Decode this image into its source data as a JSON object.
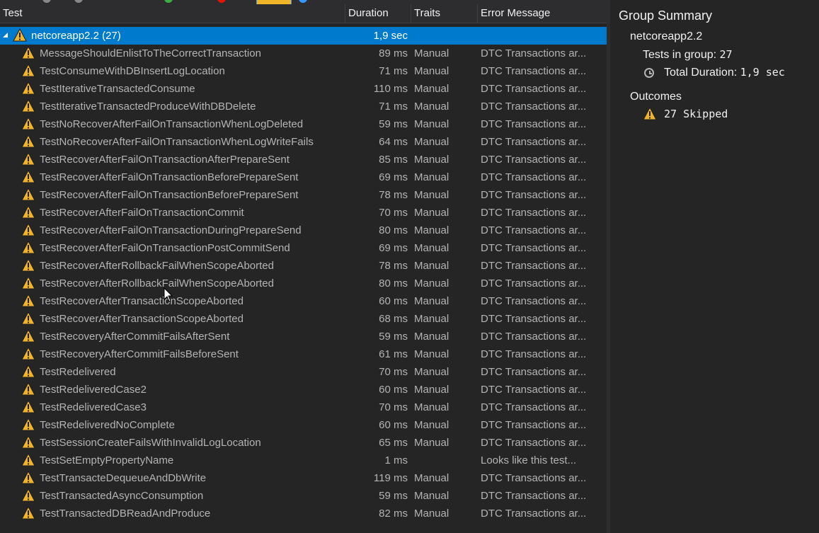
{
  "columns": {
    "test": "Test",
    "duration": "Duration",
    "traits": "Traits",
    "error": "Error Message"
  },
  "group": {
    "name": "netcoreapp2.2  (27)",
    "duration": "1,9 sec"
  },
  "rows": [
    {
      "name": "MessageShouldEnlistToTheCorrectTransaction",
      "duration": "89 ms",
      "traits": "Manual",
      "error": "DTC Transactions ar..."
    },
    {
      "name": "TestConsumeWithDBInsertLogLocation",
      "duration": "71 ms",
      "traits": "Manual",
      "error": "DTC Transactions ar..."
    },
    {
      "name": "TestIterativeTransactedConsume",
      "duration": "110 ms",
      "traits": "Manual",
      "error": "DTC Transactions ar..."
    },
    {
      "name": "TestIterativeTransactedProduceWithDBDelete",
      "duration": "71 ms",
      "traits": "Manual",
      "error": "DTC Transactions ar..."
    },
    {
      "name": "TestNoRecoverAfterFailOnTransactionWhenLogDeleted",
      "duration": "59 ms",
      "traits": "Manual",
      "error": "DTC Transactions ar..."
    },
    {
      "name": "TestNoRecoverAfterFailOnTransactionWhenLogWriteFails",
      "duration": "64 ms",
      "traits": "Manual",
      "error": "DTC Transactions ar..."
    },
    {
      "name": "TestRecoverAfterFailOnTransactionAfterPrepareSent",
      "duration": "85 ms",
      "traits": "Manual",
      "error": "DTC Transactions ar..."
    },
    {
      "name": "TestRecoverAfterFailOnTransactionBeforePrepareSent",
      "duration": "69 ms",
      "traits": "Manual",
      "error": "DTC Transactions ar..."
    },
    {
      "name": "TestRecoverAfterFailOnTransactionBeforePrepareSent",
      "duration": "78 ms",
      "traits": "Manual",
      "error": "DTC Transactions ar..."
    },
    {
      "name": "TestRecoverAfterFailOnTransactionCommit",
      "duration": "70 ms",
      "traits": "Manual",
      "error": "DTC Transactions ar..."
    },
    {
      "name": "TestRecoverAfterFailOnTransactionDuringPrepareSend",
      "duration": "80 ms",
      "traits": "Manual",
      "error": "DTC Transactions ar..."
    },
    {
      "name": "TestRecoverAfterFailOnTransactionPostCommitSend",
      "duration": "69 ms",
      "traits": "Manual",
      "error": "DTC Transactions ar..."
    },
    {
      "name": "TestRecoverAfterRollbackFailWhenScopeAborted",
      "duration": "78 ms",
      "traits": "Manual",
      "error": "DTC Transactions ar..."
    },
    {
      "name": "TestRecoverAfterRollbackFailWhenScopeAborted",
      "duration": "80 ms",
      "traits": "Manual",
      "error": "DTC Transactions ar..."
    },
    {
      "name": "TestRecoverAfterTransactionScopeAborted",
      "duration": "60 ms",
      "traits": "Manual",
      "error": "DTC Transactions ar..."
    },
    {
      "name": "TestRecoverAfterTransactionScopeAborted",
      "duration": "68 ms",
      "traits": "Manual",
      "error": "DTC Transactions ar..."
    },
    {
      "name": "TestRecoveryAfterCommitFailsAfterSent",
      "duration": "59 ms",
      "traits": "Manual",
      "error": "DTC Transactions ar..."
    },
    {
      "name": "TestRecoveryAfterCommitFailsBeforeSent",
      "duration": "61 ms",
      "traits": "Manual",
      "error": "DTC Transactions ar..."
    },
    {
      "name": "TestRedelivered",
      "duration": "70 ms",
      "traits": "Manual",
      "error": "DTC Transactions ar..."
    },
    {
      "name": "TestRedeliveredCase2",
      "duration": "60 ms",
      "traits": "Manual",
      "error": "DTC Transactions ar..."
    },
    {
      "name": "TestRedeliveredCase3",
      "duration": "70 ms",
      "traits": "Manual",
      "error": "DTC Transactions ar..."
    },
    {
      "name": "TestRedeliveredNoComplete",
      "duration": "60 ms",
      "traits": "Manual",
      "error": "DTC Transactions ar..."
    },
    {
      "name": "TestSessionCreateFailsWithInvalidLogLocation",
      "duration": "65 ms",
      "traits": "Manual",
      "error": "DTC Transactions ar..."
    },
    {
      "name": "TestSetEmptyPropertyName",
      "duration": "1 ms",
      "traits": "",
      "error": "Looks like this test..."
    },
    {
      "name": "TestTransacteDequeueAndDbWrite",
      "duration": "119 ms",
      "traits": "Manual",
      "error": "DTC Transactions ar..."
    },
    {
      "name": "TestTransactedAsyncConsumption",
      "duration": "59 ms",
      "traits": "Manual",
      "error": "DTC Transactions ar..."
    },
    {
      "name": "TestTransactedDBReadAndProduce",
      "duration": "82 ms",
      "traits": "Manual",
      "error": "DTC Transactions ar..."
    }
  ],
  "summary": {
    "title": "Group Summary",
    "group_name": "netcoreapp2.2",
    "tests_label": "Tests in group:",
    "tests_value": "27",
    "duration_label": "Total Duration:",
    "duration_value": "1,9 sec",
    "outcomes_label": "Outcomes",
    "skipped": "27 Skipped"
  },
  "colors": {
    "background": "#252526",
    "selection": "#007acc",
    "warning": "#f0b429"
  },
  "icons": {
    "warning": "warning-icon",
    "clock": "clock-icon",
    "expander": "expand-arrow-icon"
  }
}
